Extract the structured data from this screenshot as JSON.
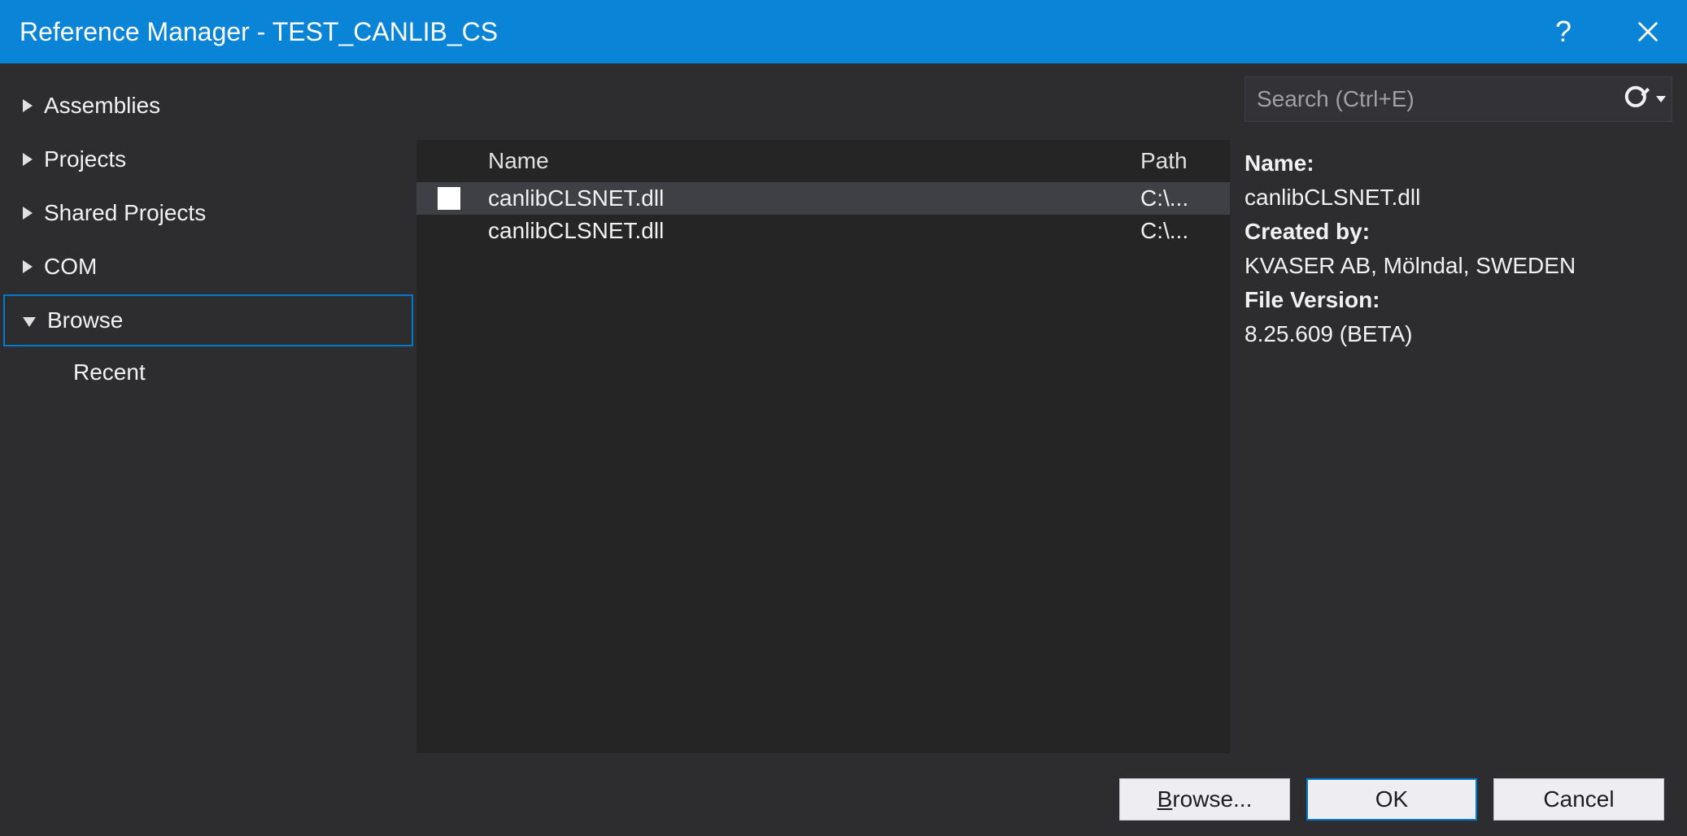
{
  "window": {
    "title": "Reference Manager - TEST_CANLIB_CS"
  },
  "sidebar": {
    "items": [
      {
        "label": "Assemblies",
        "expanded": false,
        "selected": false
      },
      {
        "label": "Projects",
        "expanded": false,
        "selected": false
      },
      {
        "label": "Shared Projects",
        "expanded": false,
        "selected": false
      },
      {
        "label": "COM",
        "expanded": false,
        "selected": false
      },
      {
        "label": "Browse",
        "expanded": true,
        "selected": true
      }
    ],
    "sub": {
      "label": "Recent"
    }
  },
  "list": {
    "headers": {
      "name": "Name",
      "path": "Path"
    },
    "rows": [
      {
        "name": "canlibCLSNET.dll",
        "path": "C:\\...",
        "selected": true,
        "showCheckbox": true
      },
      {
        "name": "canlibCLSNET.dll",
        "path": "C:\\...",
        "selected": false,
        "showCheckbox": false
      }
    ]
  },
  "search": {
    "placeholder": "Search (Ctrl+E)",
    "value": ""
  },
  "details": {
    "name_label": "Name:",
    "name_value": "canlibCLSNET.dll",
    "created_label": "Created by:",
    "created_value": "KVASER AB, Mölndal, SWEDEN",
    "version_label": "File Version:",
    "version_value": "8.25.609 (BETA)"
  },
  "footer": {
    "browse_prefix": "B",
    "browse_suffix": "rowse...",
    "ok": "OK",
    "cancel": "Cancel"
  }
}
